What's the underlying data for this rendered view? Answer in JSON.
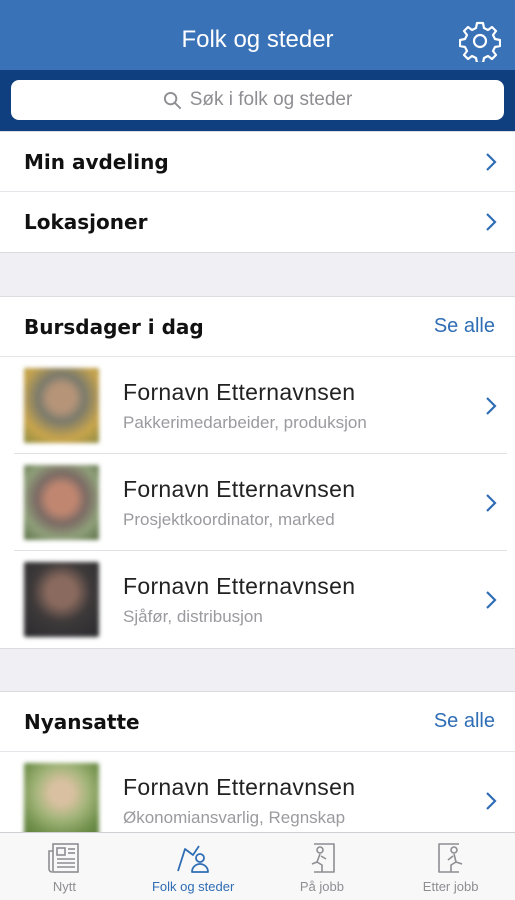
{
  "header": {
    "title": "Folk og steder",
    "settings_icon": "gear-icon"
  },
  "search": {
    "placeholder": "Søk i folk og steder",
    "icon": "search-icon"
  },
  "nav_rows": [
    {
      "label": "Min avdeling"
    },
    {
      "label": "Lokasjoner"
    }
  ],
  "birthdays": {
    "title": "Bursdager i dag",
    "see_all": "Se alle",
    "people": [
      {
        "name": "Fornavn Etternavnsen",
        "role": "Pakkerimedarbeider, produksjon"
      },
      {
        "name": "Fornavn Etternavnsen",
        "role": "Prosjektkoordinator, marked"
      },
      {
        "name": "Fornavn Etternavnsen",
        "role": "Sjåfør, distribusjon"
      }
    ]
  },
  "new_hires": {
    "title": "Nyansatte",
    "see_all": "Se alle",
    "people": [
      {
        "name": "Fornavn Etternavnsen",
        "role": "Økonomiansvarlig, Regnskap"
      }
    ]
  },
  "tabs": [
    {
      "label": "Nytt",
      "icon": "newspaper-icon",
      "active": false
    },
    {
      "label": "Folk og steder",
      "icon": "people-map-icon",
      "active": true
    },
    {
      "label": "På jobb",
      "icon": "at-work-icon",
      "active": false
    },
    {
      "label": "Etter jobb",
      "icon": "after-work-icon",
      "active": false
    }
  ],
  "colors": {
    "header": "#3a72b8",
    "search_band": "#0f3f7e",
    "accent": "#2f6db5"
  }
}
